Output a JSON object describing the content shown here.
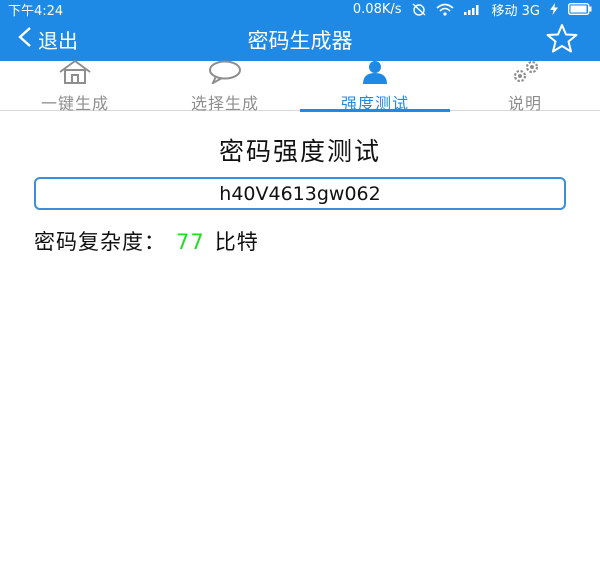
{
  "status_bar": {
    "time": "下午4:24",
    "net_speed": "0.08K/s",
    "carrier": "移动 3G"
  },
  "app_bar": {
    "back_label": "退出",
    "title": "密码生成器",
    "favorite_icon": "star-outline-icon"
  },
  "tabs": [
    {
      "label": "一键生成",
      "icon": "home-icon",
      "active": false
    },
    {
      "label": "选择生成",
      "icon": "chat-bubble-icon",
      "active": false
    },
    {
      "label": "强度测试",
      "icon": "user-icon",
      "active": true
    },
    {
      "label": "说明",
      "icon": "gears-icon",
      "active": false
    }
  ],
  "main": {
    "heading": "密码强度测试",
    "password_value": "h40V4613gw062",
    "complexity_label": "密码复杂度：",
    "complexity_value": "77",
    "complexity_unit": "比特"
  },
  "colors": {
    "primary": "#1f8ae6",
    "inactive_tab": "#8e8e8e",
    "complexity_value": "#22dd22"
  }
}
